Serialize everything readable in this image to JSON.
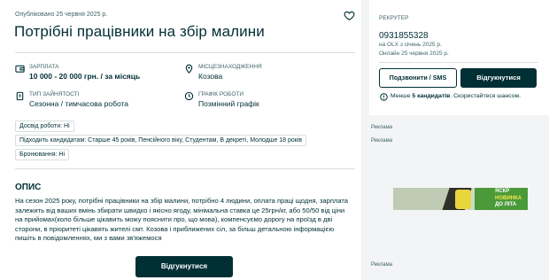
{
  "posted": "Опубліковано 25 червня 2025 р.",
  "title": "Потрібні працівники на збір малини",
  "details": {
    "salary_label": "ЗАРПЛАТА",
    "salary_value": "10 000 - 20 000 грн. / за місяць",
    "location_label": "МІСЦЕЗНАХОДЖЕННЯ",
    "location_value": "Козова",
    "employment_label": "ТИП ЗАЙНЯТОСТІ",
    "employment_value": "Сезонна / тимчасова робота",
    "schedule_label": "ГРАФІК РОБОТИ",
    "schedule_value": "Позмінний графік"
  },
  "tags": [
    "Досвід роботи: Ні",
    "Підходить кандидатам: Старше 45 років, Пенсійного віку, Студентам, В декреті, Молодше 18 років",
    "Бронювання: Ні"
  ],
  "description": {
    "heading": "ОПИС",
    "text": "На сезон 2025 року, потрібні працівники на збір малини, потрібно 4 людини, оплата праці щодня, зарплата залежить від ваших вмінь збирати швидко і якісно ягоду, мінімальна ставка це 25грн/кг, або 50/50 від ціни на прийомах(коло більше цікавить можу пояснити про, що мова), компенсуємо дорогу на проїзд в дві сторони, в пріоритеті цікавять жителі смт. Козова і приближених сіл, за більш детальною інформацією пишіть в повідомленнях, ми з вами зв'яжемося"
  },
  "apply_button": "Відгукнутися",
  "recruiter": {
    "label": "РЕКРУТЕР",
    "name": "0931855328",
    "since": "на OLX з січень 2025 р.",
    "online": "Онлайн 25 червня 2025 р.",
    "call_button": "Подзвонити / SMS",
    "apply_button": "Відгукнутися",
    "hint_prefix": "Менше",
    "hint_count": "5 кандидатів",
    "hint_suffix": ". Скористайтеся шансом."
  },
  "ads": {
    "label1": "Реклама",
    "label2": "Реклама",
    "label3": "Реклама",
    "banner_line1": "ЯСКР",
    "banner_line2": "НОВИНКА",
    "banner_line3": "ДО ЛІТА"
  },
  "colors": {
    "brand": "#002f34",
    "muted": "#406367",
    "background": "#f2f4f5"
  }
}
